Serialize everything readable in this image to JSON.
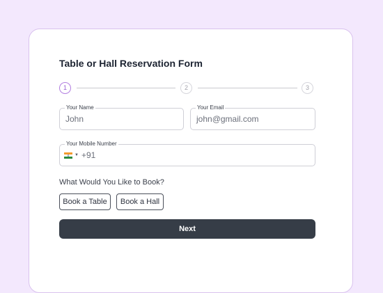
{
  "form": {
    "title": "Table or Hall Reservation Form",
    "steps": [
      "1",
      "2",
      "3"
    ],
    "active_step": 1,
    "name_field": {
      "label": "Your Name",
      "value": "John"
    },
    "email_field": {
      "label": "Your Email",
      "value": "john@gmail.com"
    },
    "mobile_field": {
      "label": "Your Mobile Number",
      "country_code": "+91",
      "flag": "india-flag-icon"
    },
    "booking_question": "What Would You Like to Book?",
    "options": [
      "Book a Table",
      "Book a Hall"
    ],
    "next_label": "Next"
  },
  "colors": {
    "page_background": "#f3e8fd",
    "card_border": "#d9c2ee",
    "active_step": "#9a5fd4",
    "primary_button": "#363d47"
  }
}
